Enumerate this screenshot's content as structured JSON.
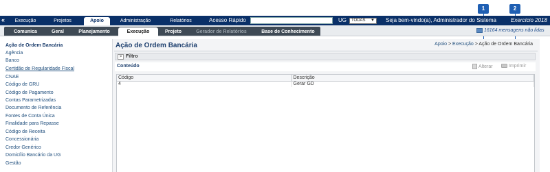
{
  "top_nav": {
    "collapse_icon": "double-chevron-left-icon",
    "tabs": [
      {
        "label": "Execução"
      },
      {
        "label": "Projetos"
      },
      {
        "label": "Apoio"
      },
      {
        "label": "Administração"
      },
      {
        "label": "Relatórios"
      }
    ],
    "active_tab": "Apoio",
    "quick_access_label": "Acesso Rápido",
    "quick_access_value": "",
    "ug_label": "UG",
    "ug_selected": "TODAS",
    "welcome": "Seja bem-vindo(a), Administrador do Sistema",
    "year": "Exercício 2018"
  },
  "sub_nav": {
    "tabs": [
      {
        "label": "Comunica"
      },
      {
        "label": "Geral"
      },
      {
        "label": "Planejamento"
      },
      {
        "label": "Execução"
      },
      {
        "label": "Projeto"
      },
      {
        "label": "Gerador de Relatórios"
      },
      {
        "label": "Base de Conhecimento"
      }
    ],
    "active_tab": "Execução",
    "messages_icon": "envelope-icon",
    "messages_text": "16164 mensagens não lidas"
  },
  "sidebar": {
    "items": [
      {
        "label": "Ação de Ordem Bancária"
      },
      {
        "label": "Agência"
      },
      {
        "label": "Banco"
      },
      {
        "label": "Certidão de Regularidade Fiscal"
      },
      {
        "label": "CNAE"
      },
      {
        "label": "Código de GRU"
      },
      {
        "label": "Código de Pagamento"
      },
      {
        "label": "Contas Parametrizadas"
      },
      {
        "label": "Documento de Referência"
      },
      {
        "label": "Fontes de Conta Única"
      },
      {
        "label": "Finalidade para Repasse"
      },
      {
        "label": "Código de Receita"
      },
      {
        "label": "Concessionária"
      },
      {
        "label": "Credor Genérico"
      },
      {
        "label": "Domicílio Bancário da UG"
      },
      {
        "label": "Gestão"
      }
    ]
  },
  "page": {
    "title": "Ação de Ordem Bancária",
    "breadcrumb": {
      "part1": "Apoio",
      "sep1": " > ",
      "part2": "Execução",
      "sep2": " > ",
      "part3": "Ação de Ordem Bancária"
    },
    "filter_label": "Filtro",
    "filter_toggle_icon": "chevron-right-icon",
    "content_label": "Conteúdo",
    "toolbar": {
      "alterar_label": "Alterar",
      "alterar_icon": "document-icon",
      "imprimir_label": "Imprimir",
      "imprimir_icon": "printer-icon"
    }
  },
  "table": {
    "columns": [
      "Código",
      "Descrição"
    ],
    "rows": [
      [
        "4",
        "Gerar GD"
      ]
    ]
  },
  "annotations": [
    {
      "label": "1"
    },
    {
      "label": "2"
    }
  ],
  "colors": {
    "nav_navy": "#0a3068",
    "subnav_dark": "#3f4a55",
    "link_blue": "#23517f",
    "annotation_blue": "#1f5fb3"
  }
}
